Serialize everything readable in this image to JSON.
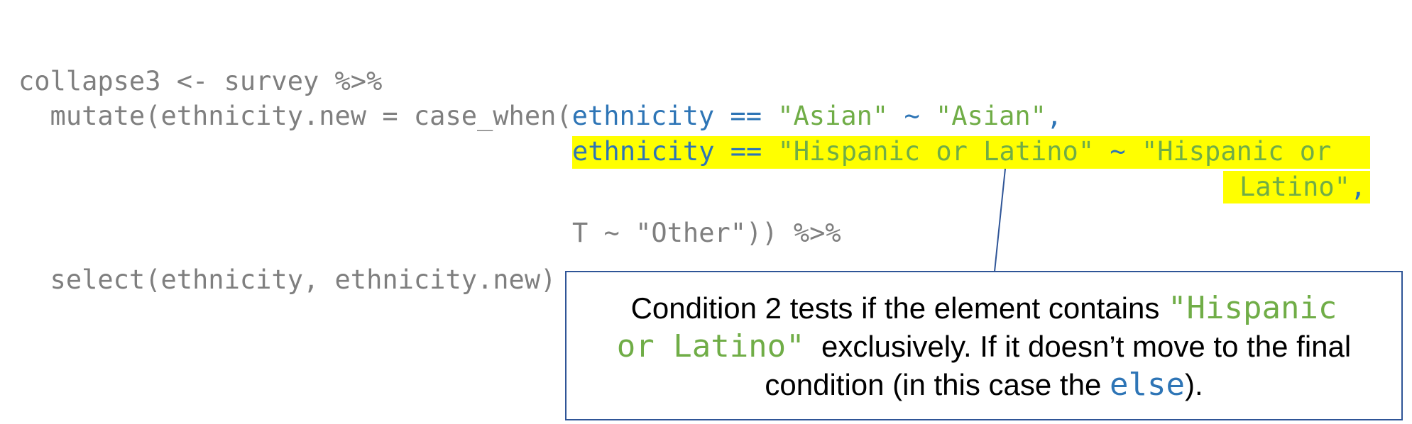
{
  "code": {
    "line1": "collapse3 <- survey %>%",
    "line2_prefix": "  mutate(ethnicity.new = case_when(",
    "cond1_var": "ethnicity",
    "cond1_op": " == ",
    "cond1_val": "\"Asian\"",
    "cond1_tilde": " ~ ",
    "cond1_result": "\"Asian\"",
    "cond1_comma": ",",
    "cond2_var": "ethnicity",
    "cond2_op": " == ",
    "cond2_val": "\"Hispanic or Latino\"",
    "cond2_tilde": " ~ ",
    "cond2_result_part1": "\"Hispanic or",
    "cond2_result_part2": "Latino\"",
    "cond2_comma": ",",
    "cond3": "T ~ \"Other\")) %>%",
    "line_select": "  select(ethnicity, ethnicity.new)"
  },
  "callout": {
    "text1": "Condition 2 tests if the element contains ",
    "code1": "\"Hispanic",
    "code2": "or Latino\"",
    "text2": "  exclusively. If it doesn’t move to the final",
    "text3": "condition (in this case the ",
    "code3": "else",
    "text4": ")."
  },
  "colors": {
    "code_grey": "#7f7f7f",
    "keyword_blue": "#2e75b6",
    "string_green": "#70ad47",
    "highlight": "#ffff00",
    "callout_border": "#2f5597"
  }
}
